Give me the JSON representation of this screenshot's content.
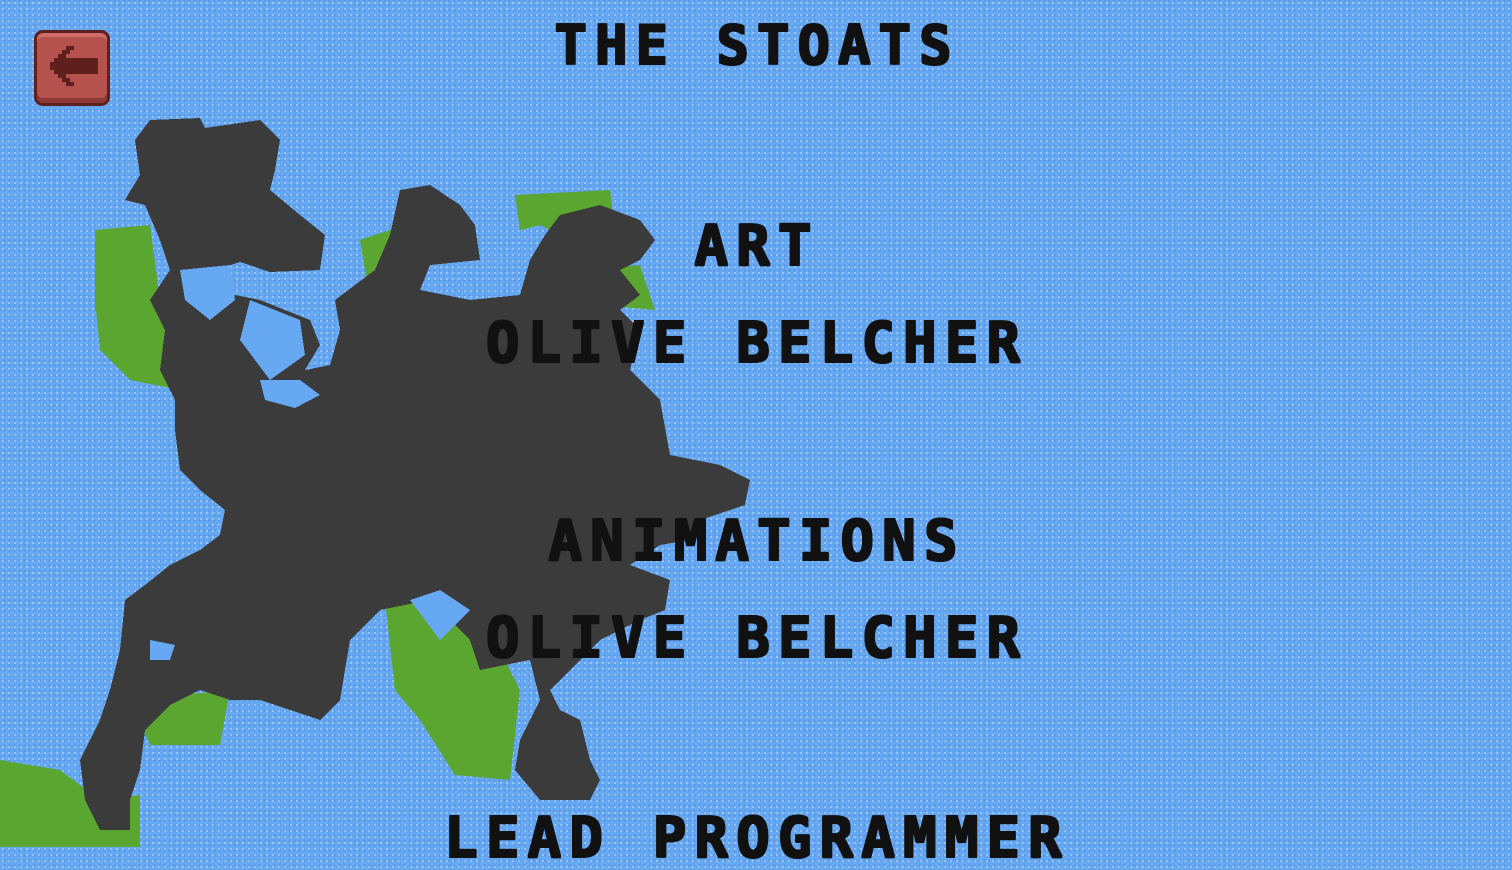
{
  "credits": {
    "title": "THE STOATS",
    "sections": [
      {
        "role": "ART",
        "name": "OLIVE BELCHER"
      },
      {
        "role": "ANIMATIONS",
        "name": "OLIVE BELCHER"
      },
      {
        "role": "LEAD PROGRAMMER"
      }
    ]
  },
  "back_button": {
    "icon": "arrow-left-icon"
  },
  "colors": {
    "water": "#66a8f2",
    "land": "#3b3b3b",
    "grass": "#5aa631",
    "button": "#b5524e",
    "text": "#111111"
  }
}
